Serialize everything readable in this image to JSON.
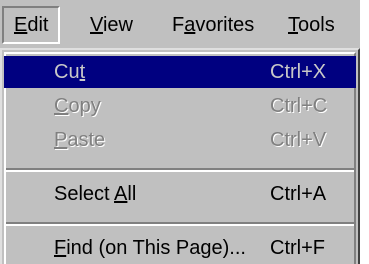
{
  "menubar": {
    "items": [
      {
        "pre": "",
        "key": "E",
        "post": "dit"
      },
      {
        "pre": "",
        "key": "V",
        "post": "iew"
      },
      {
        "pre": "F",
        "key": "a",
        "post": "vorites"
      },
      {
        "pre": "",
        "key": "T",
        "post": "ools"
      }
    ]
  },
  "edit_menu": {
    "cut": {
      "pre": "Cu",
      "key": "t",
      "post": "",
      "shortcut": "Ctrl+X",
      "state": "highlighted, disabled"
    },
    "copy": {
      "pre": "",
      "key": "C",
      "post": "opy",
      "shortcut": "Ctrl+C",
      "state": "disabled"
    },
    "paste": {
      "pre": "",
      "key": "P",
      "post": "aste",
      "shortcut": "Ctrl+V",
      "state": "disabled"
    },
    "select_all": {
      "pre": "Select ",
      "key": "A",
      "post": "ll",
      "shortcut": "Ctrl+A"
    },
    "find": {
      "pre": "",
      "key": "F",
      "post": "ind (on This Page)...",
      "shortcut": "Ctrl+F"
    }
  },
  "colors": {
    "menu_face": "#c0c0c0",
    "highlight": "#000080",
    "disabled_text": "#808080"
  }
}
